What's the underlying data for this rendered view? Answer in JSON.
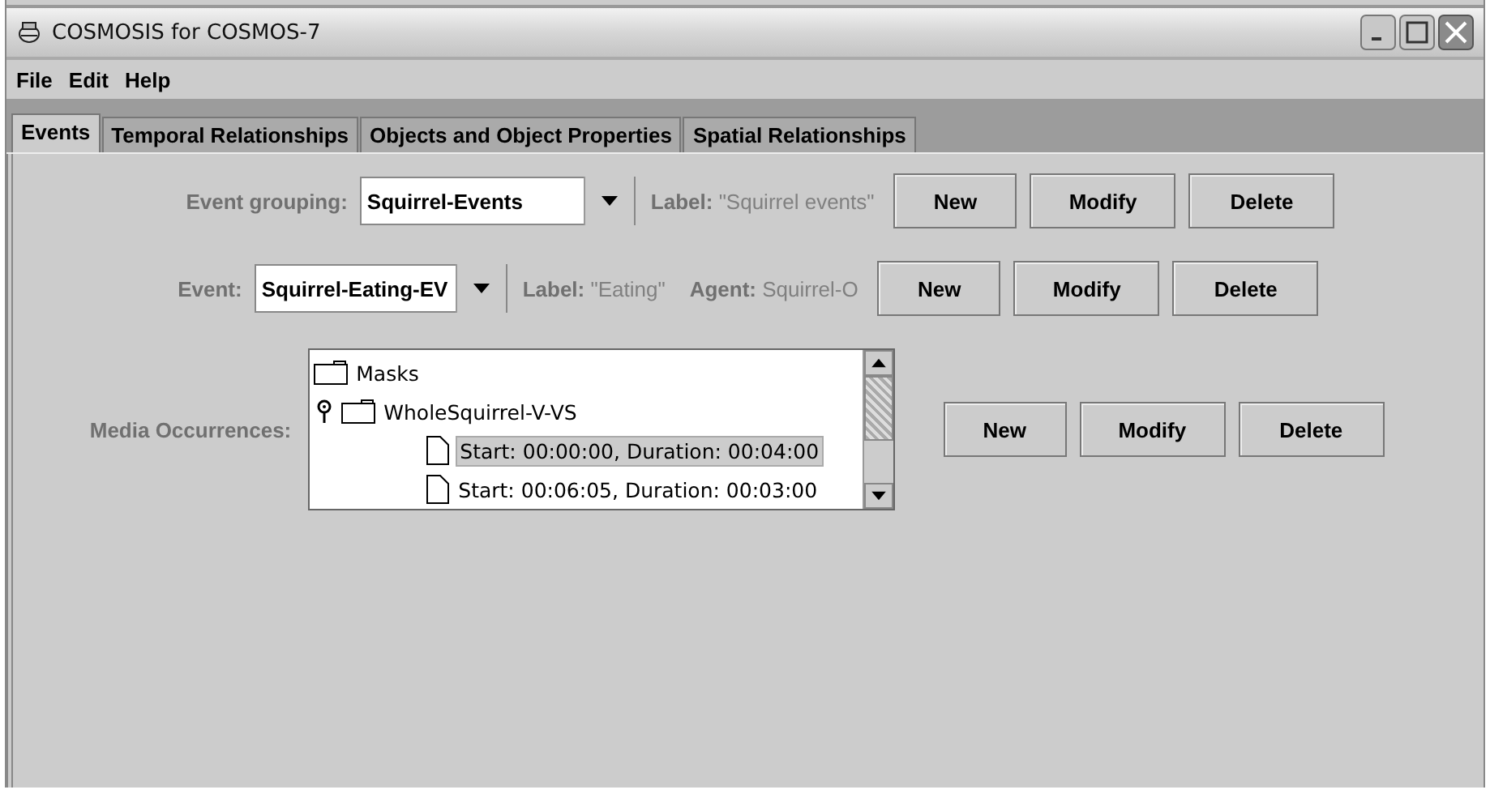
{
  "window": {
    "title": "COSMOSIS for COSMOS-7"
  },
  "menu": [
    "File",
    "Edit",
    "Help"
  ],
  "tabs": [
    {
      "label": "Events",
      "selected": true
    },
    {
      "label": "Temporal Relationships",
      "selected": false
    },
    {
      "label": "Objects and Object Properties",
      "selected": false
    },
    {
      "label": "Spatial Relationships",
      "selected": false
    }
  ],
  "event_grouping": {
    "label": "Event grouping:",
    "value": "Squirrel-Events",
    "info": [
      {
        "key": "Label:",
        "value": "\"Squirrel events\""
      }
    ],
    "buttons": [
      "New",
      "Modify",
      "Delete"
    ]
  },
  "event": {
    "label": "Event:",
    "value": "Squirrel-Eating-EV",
    "info": [
      {
        "key": "Label:",
        "value": "\"Eating\""
      },
      {
        "key": "Agent:",
        "value": "Squirrel-O"
      }
    ],
    "buttons": [
      "New",
      "Modify",
      "Delete"
    ]
  },
  "media_occurrences": {
    "label": "Media Occurrences:",
    "tree": [
      {
        "label": "Masks",
        "kind": "folder",
        "selected": false
      },
      {
        "label": "WholeSquirrel-V-VS",
        "kind": "folder",
        "expanded": true,
        "selected": false,
        "children": [
          {
            "label": "Start: 00:00:00, Duration: 00:04:00",
            "kind": "file",
            "selected": true
          },
          {
            "label": "Start: 00:06:05, Duration: 00:03:00",
            "kind": "file",
            "selected": false
          }
        ]
      }
    ],
    "buttons": [
      "New",
      "Modify",
      "Delete"
    ]
  }
}
